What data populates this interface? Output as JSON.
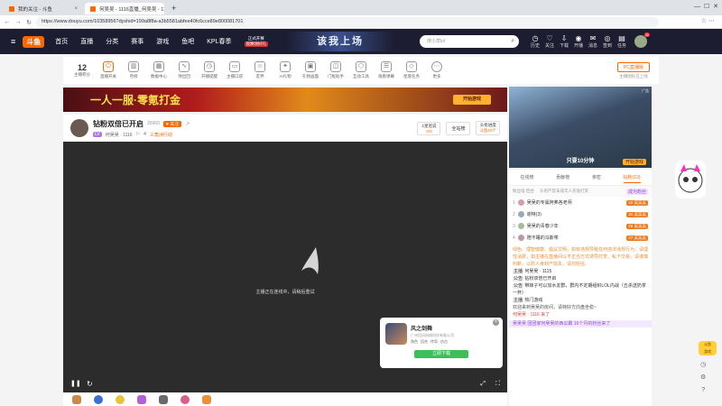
{
  "browser": {
    "tabs": [
      {
        "title": "我的关注 - 斗鱼"
      },
      {
        "title": "何吴吴 - 1116直播_何吴吴 - 1116斗"
      }
    ],
    "url": "https://www.douyu.com/10358956?dyshid=199a8f8a-a3b5581abfee40fc6cce89e800081701",
    "new_tab": "+",
    "back": "←",
    "forward": "→",
    "reload": "↻"
  },
  "site": {
    "logo": "斗鱼",
    "nav": [
      "首页",
      "直播",
      "分类",
      "赛事",
      "游戏",
      "鱼吧",
      "KPL春季"
    ],
    "promo_line1": "正式开赛",
    "promo_line2": "观赛领好礼",
    "banner_text": "该我上场",
    "search_placeholder": "搜小草lol",
    "icons": [
      "历史",
      "关注",
      "下载",
      "开播",
      "消息",
      "签到",
      "任务"
    ],
    "avatar_count": "11"
  },
  "tools": {
    "level": "12",
    "level_label": "主播积分",
    "items": [
      "直播开关",
      "月榜",
      "数据中心",
      "弹出回",
      "开播提醒",
      "主播口袋",
      "友界",
      "AI礼物",
      "礼物画面",
      "门框助手",
      "互动工具",
      "观看弹幕",
      "星座任务",
      "更多"
    ],
    "pc_button": "PC直播版",
    "pc_sub": "主播图标已上线"
  },
  "banner": {
    "text": "一人一服·零氪打金",
    "cta": "开始游戏"
  },
  "room": {
    "title": "钻粉双倍已开启",
    "hot": "26960",
    "follow": "关注",
    "streamer": "何吴吴 · 1116",
    "fans": "4",
    "category": "三角洲行动",
    "rank_label": "1星巡说",
    "rank_value": "0/3",
    "all_btn": "全站榜",
    "tasks": "头衔进度",
    "tasks_sub": "斗鱼10个"
  },
  "player": {
    "status": "主播正在连线中，请稍后重试",
    "play": "❚❚",
    "refresh": "↻"
  },
  "popup": {
    "name": "风之剑舞",
    "company": "广州回风网络科技有限公司",
    "tags": [
      "角色",
      "回合",
      "传奇",
      "仿古"
    ],
    "btn": "立即下载",
    "close": "×"
  },
  "ad2": {
    "label": "广告",
    "title": "只要10分钟",
    "cta": "开始游戏"
  },
  "chat": {
    "tabs": [
      "在线榜",
      "贡献榜",
      "亲密",
      "钻粉(13)"
    ],
    "sub": [
      "粉丝墙·回合",
      "头衔严禁未成年人充值打赏",
      "成为粉丝"
    ],
    "ranks": [
      {
        "n": "1",
        "name": "吴吴的专属阿弗各老师",
        "lv": "42",
        "tag": "吴吴吴"
      },
      {
        "n": "2",
        "name": "谢特(3)",
        "lv": "31",
        "tag": "吴吴吴"
      },
      {
        "n": "3",
        "name": "吴吴的青春少年",
        "lv": "28",
        "tag": "吴吴吴"
      },
      {
        "n": "4",
        "name": "陪不睡的马斯嗦",
        "lv": "27",
        "tag": "吴吴吴"
      }
    ],
    "notice": "绿色、理智健康、倡议文明。如有违规导致任何违法违规行为，请理性消费，如主播在直播间以不正当方式诱导打赏、私下交易，请谨慎判断，以防人身财产损失，请勿轻信。",
    "messages": [
      {
        "role": "主播",
        "name": "何吴吴 · 1115"
      },
      {
        "role": "公告",
        "name": "钻粉双倍已开启"
      },
      {
        "role": "公告",
        "name": "带妹子可以加水友群，群内不定期组织LOL内战（五杀送奶茶一杯）"
      },
      {
        "role": "主播",
        "name": "热门游戏"
      }
    ],
    "welcome": "欢迎来到吴吴的房间，请特好方向盘坐稳~",
    "join1": "何吴吴 · 1116 来了",
    "join2": "吴吴吴 团团家何吴吴的西瓜霸 16个月的粉丝来了"
  },
  "side_tools": [
    "关注",
    "收藏",
    "分享",
    "设置"
  ]
}
